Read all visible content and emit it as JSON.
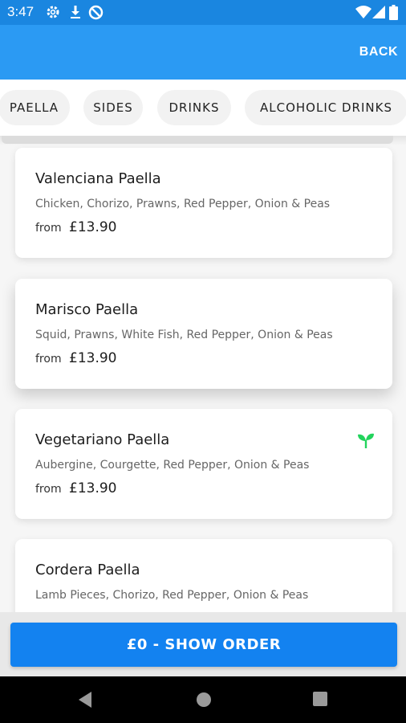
{
  "status_bar": {
    "time": "3:47",
    "left_icons": [
      "gear-icon",
      "download-icon",
      "data-saver-icon"
    ],
    "right_icons": [
      "wifi-icon",
      "signal-icon",
      "battery-icon"
    ]
  },
  "app_bar": {
    "back_label": "BACK",
    "color": "#2b9af3"
  },
  "tabs": [
    {
      "label": "PAELLA"
    },
    {
      "label": "SIDES"
    },
    {
      "label": "DRINKS"
    },
    {
      "label": "ALCOHOLIC DRINKS"
    }
  ],
  "menu_items": [
    {
      "name": "Valenciana Paella",
      "description": "Chicken, Chorizo, Prawns, Red Pepper, Onion & Peas",
      "from_label": "from",
      "price": "£13.90"
    },
    {
      "name": "Marisco Paella",
      "description": "Squid, Prawns, White Fish, Red Pepper, Onion & Peas",
      "from_label": "from",
      "price": "£13.90"
    },
    {
      "name": "Vegetariano Paella",
      "description": "Aubergine, Courgette, Red Pepper, Onion & Peas",
      "from_label": "from",
      "price": "£13.90",
      "icon": "vegetarian-sprout-icon"
    },
    {
      "name": "Cordera Paella",
      "description": "Lamb Pieces, Chorizo, Red Pepper, Onion & Peas"
    }
  ],
  "order_button": {
    "label": "£0 - SHOW ORDER",
    "color": "#1382f0"
  },
  "nav_bar": {
    "icons": [
      "back-triangle-icon",
      "home-circle-icon",
      "recents-square-icon"
    ]
  },
  "accent_colors": {
    "vegetarian": "#22d35c"
  }
}
